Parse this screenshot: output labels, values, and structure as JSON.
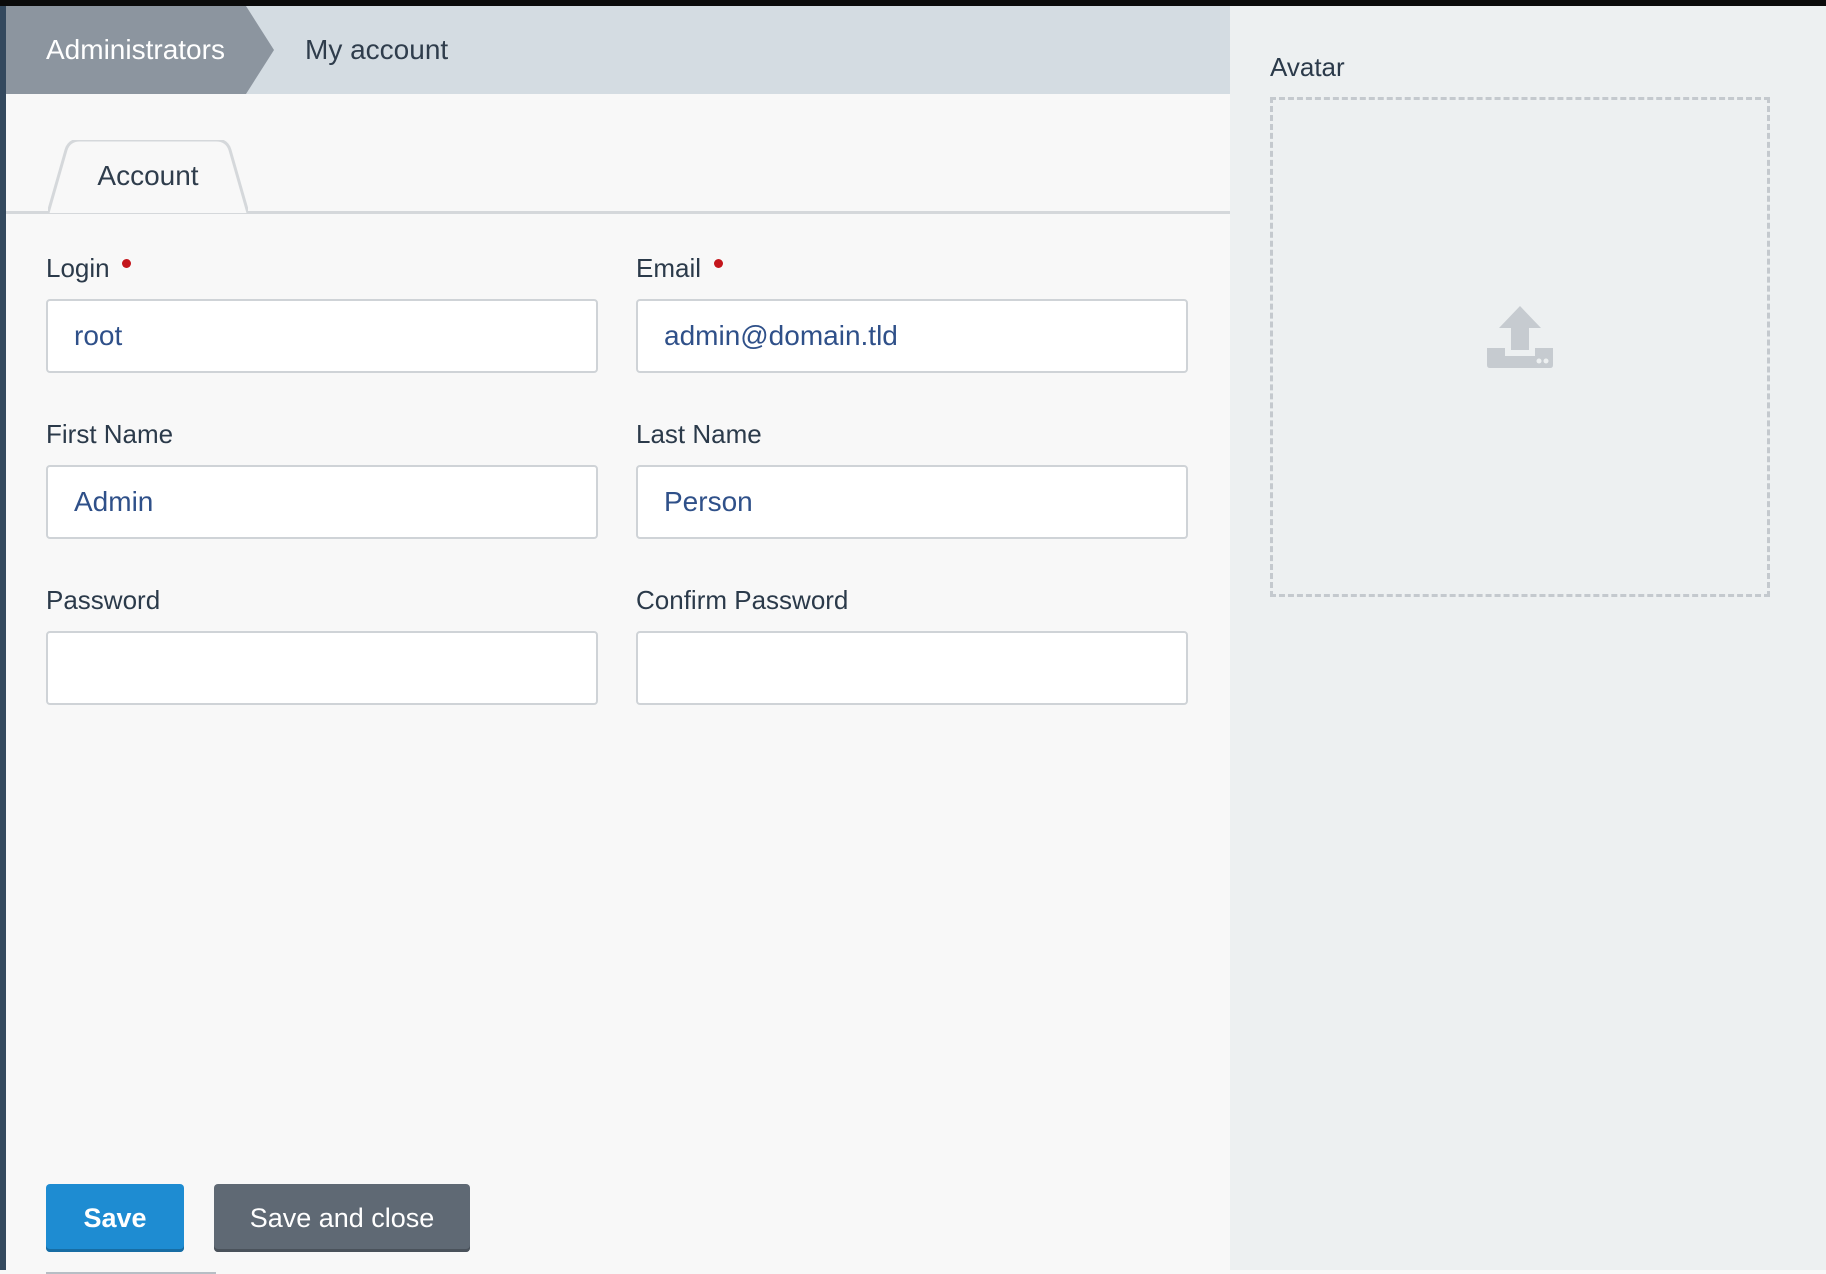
{
  "breadcrumb": {
    "parent": "Administrators",
    "current": "My account"
  },
  "tabs": [
    {
      "label": "Account"
    }
  ],
  "form": {
    "login": {
      "label": "Login",
      "value": "root",
      "required": true
    },
    "email": {
      "label": "Email",
      "value": "admin@domain.tld",
      "required": true
    },
    "first_name": {
      "label": "First Name",
      "value": "Admin"
    },
    "last_name": {
      "label": "Last Name",
      "value": "Person"
    },
    "password": {
      "label": "Password",
      "value": ""
    },
    "confirm_password": {
      "label": "Confirm Password",
      "value": ""
    }
  },
  "actions": {
    "save_label": "Save",
    "save_close_label": "Save and close"
  },
  "avatar": {
    "label": "Avatar",
    "icon": "upload-icon"
  },
  "colors": {
    "primary": "#1e8cd2",
    "required": "#c4161c",
    "input_text": "#2f5089"
  }
}
